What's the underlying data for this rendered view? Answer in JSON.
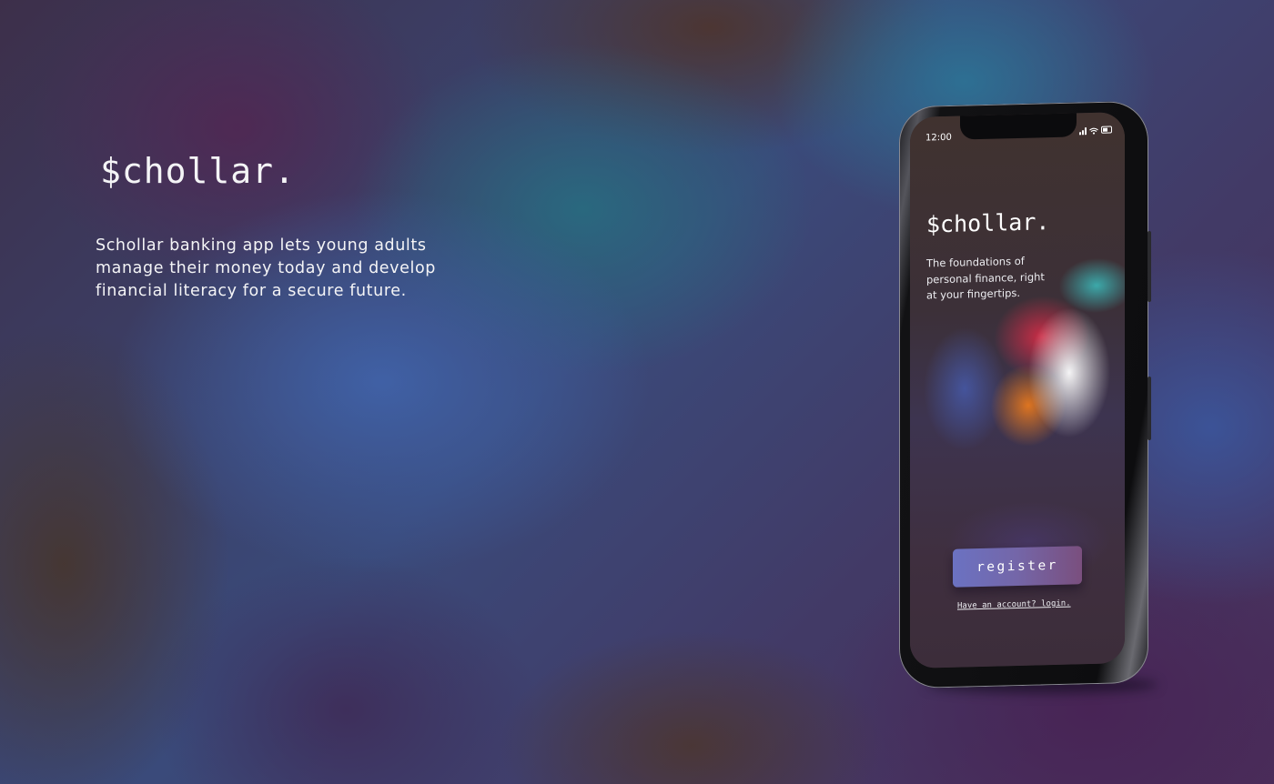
{
  "hero": {
    "brand": "$chollar.",
    "description": "Schollar banking app lets young adults manage their money today and develop financial literacy for a secure future."
  },
  "phone": {
    "status_time": "12:00",
    "status_icons": [
      "signal-icon",
      "wifi-icon",
      "battery-icon"
    ],
    "app": {
      "brand": "$chollar.",
      "tagline": "The foundations of personal finance, right at your fingertips.",
      "register_label": "register",
      "login_link": "Have an account? login."
    }
  },
  "colors": {
    "register_gradient": [
      "#6b72c2",
      "#7a4f7e"
    ],
    "text": "#f4f4f6"
  }
}
